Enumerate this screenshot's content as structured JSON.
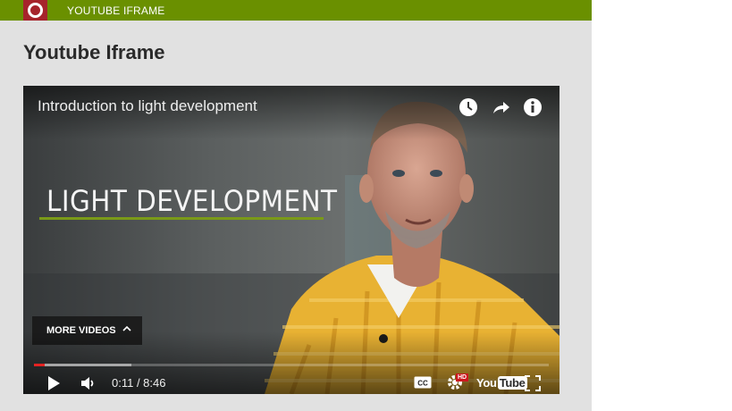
{
  "header": {
    "title": "YOUTUBE IFRAME"
  },
  "page": {
    "title": "Youtube Iframe"
  },
  "player": {
    "video_title": "Introduction to light development",
    "overlay_text": "LIGHT DEVELOPMENT",
    "more_videos_label": "MORE VIDEOS",
    "current_time": "0:11",
    "duration": "8:46",
    "time_display": "0:11 / 8:46",
    "played_fraction": 0.021,
    "buffered_fraction": 0.19,
    "hd_badge": "HD",
    "youtube_logo_you": "You",
    "youtube_logo_tube": "Tube",
    "cc_label": "CC",
    "icons": [
      "watch-later-icon",
      "share-icon",
      "info-icon",
      "play-icon",
      "volume-icon",
      "captions-icon",
      "settings-icon",
      "youtube-logo",
      "fullscreen-icon"
    ]
  },
  "below": {
    "link_text": ""
  },
  "colors": {
    "header_bar": "#6a9000",
    "logo_red": "#a6242b",
    "panel_bg": "#e1e1e1",
    "overlay_underline": "#7a9a18",
    "progress_red": "#e52222",
    "shirt_yellow": "#e8b233"
  }
}
